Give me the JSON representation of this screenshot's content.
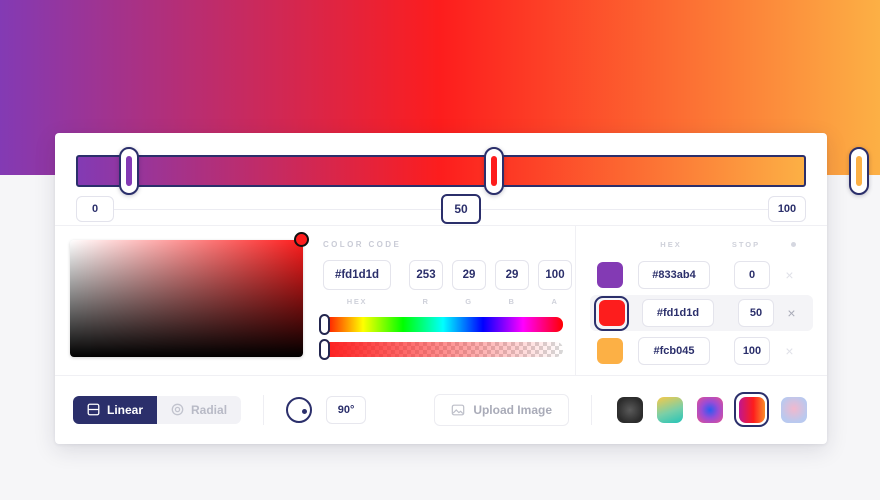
{
  "banner": {
    "gradient_css": "linear-gradient(90deg, #833ab4 0%, #fd1d1d 50%, #fcb045 100%)"
  },
  "preview": {
    "gradient_css": "linear-gradient(90deg, #833ab4 0%, #fd1d1d 50%, #fcb045 100%)",
    "handles": [
      {
        "position": 0,
        "color": "#833ab4"
      },
      {
        "position": 50,
        "color": "#fd1d1d"
      },
      {
        "position": 100,
        "color": "#fcb045"
      }
    ],
    "stop_inputs": [
      {
        "value": "0",
        "active": false
      },
      {
        "value": "50",
        "active": true
      },
      {
        "value": "100",
        "active": false
      }
    ]
  },
  "color_picker": {
    "selected_color": "#fd1d1d",
    "hue_slider": {
      "name": "hue-slider",
      "handle_position": 0
    },
    "alpha_slider": {
      "name": "alpha-slider",
      "handle_position": 0
    }
  },
  "color_code": {
    "section_label": "COLOR CODE",
    "hex": {
      "value": "#fd1d1d",
      "caption": "HEX"
    },
    "channels": [
      {
        "value": "253",
        "caption": "R"
      },
      {
        "value": "29",
        "caption": "G"
      },
      {
        "value": "29",
        "caption": "B"
      },
      {
        "value": "100",
        "caption": "A"
      }
    ]
  },
  "stops_panel": {
    "headers": {
      "hex": "HEX",
      "stop": "STOP",
      "remove": "dot-icon"
    },
    "rows": [
      {
        "color": "#833ab4",
        "hex": "#833ab4",
        "stop": "0",
        "selected": false,
        "remove_label": "×"
      },
      {
        "color": "#fd1d1d",
        "hex": "#fd1d1d",
        "stop": "50",
        "selected": true,
        "remove_label": "×"
      },
      {
        "color": "#fcb045",
        "hex": "#fcb045",
        "stop": "100",
        "selected": false,
        "remove_label": "×"
      }
    ]
  },
  "footer": {
    "type_toggle": {
      "linear_label": "Linear",
      "radial_label": "Radial",
      "active": "Linear"
    },
    "angle": {
      "value": "90°"
    },
    "upload_label": "Upload Image",
    "presets": [
      {
        "name": "preset-dark-radial",
        "css": "radial-gradient(circle at 50% 50%, #5a5a5a 0%, #2c2c2c 70%)",
        "selected": false
      },
      {
        "name": "preset-yellow-teal",
        "css": "linear-gradient(160deg, #f7c948 0%, #79cfa8 55%, #23c4b8 100%)",
        "selected": false
      },
      {
        "name": "preset-pink-blue-radial",
        "css": "radial-gradient(circle at 50% 50%, #2b5cf0 0%, #9a4bd6 45%, #e8528f 100%)",
        "selected": false
      },
      {
        "name": "preset-magenta-red-orange",
        "css": "linear-gradient(90deg, #c1168f 0%, #fd1d1d 55%, #fc8c2a 100%)",
        "selected": true
      },
      {
        "name": "preset-light-blue-pink",
        "css": "radial-gradient(circle at 50% 45%, #f2b8cd 0%, #b9c9ef 70%)",
        "selected": false
      }
    ]
  }
}
